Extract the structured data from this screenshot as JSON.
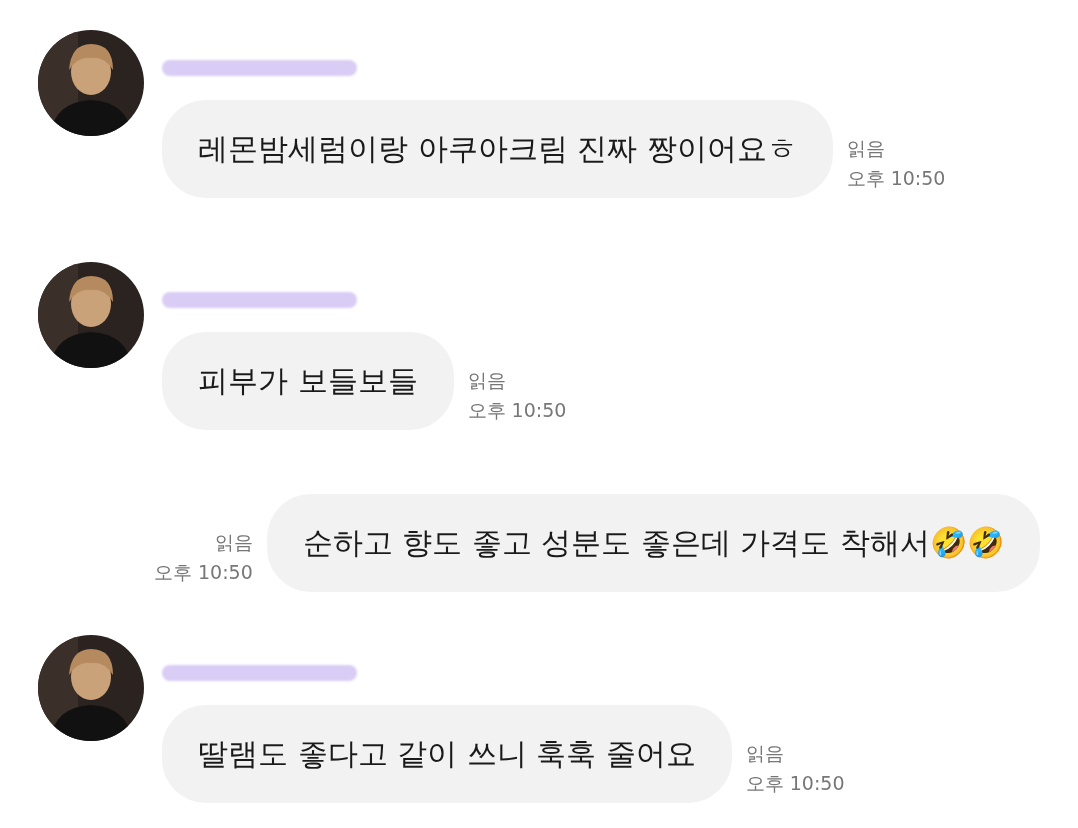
{
  "messages": [
    {
      "kind": "incoming",
      "text": "레몬밤세럼이랑 아쿠아크림 진짜 짱이어요ㅎ",
      "read": "읽음",
      "time": "오후 10:50"
    },
    {
      "kind": "incoming",
      "text": "피부가 보들보들",
      "read": "읽음",
      "time": "오후 10:50"
    },
    {
      "kind": "outgoing",
      "text": "순하고 향도 좋고 성분도 좋은데 가격도 착해서🤣🤣",
      "read": "읽음",
      "time": "오후 10:50"
    },
    {
      "kind": "incoming",
      "text": "딸램도 좋다고 같이 쓰니 훅훅 줄어요",
      "read": "읽음",
      "time": "오후 10:50"
    }
  ]
}
